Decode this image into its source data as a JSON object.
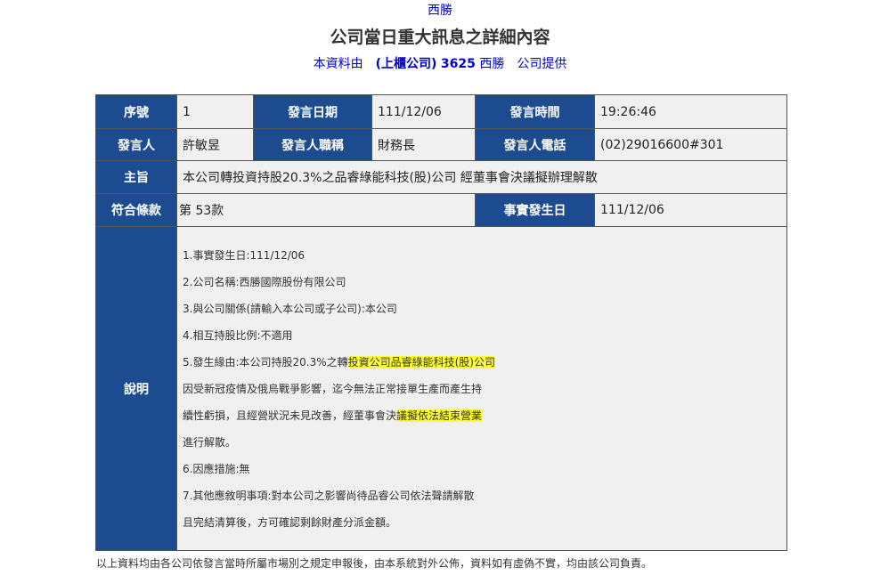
{
  "header": {
    "company_link": "西勝",
    "title": "公司當日重大訊息之詳細內容",
    "provider_prefix": "本資料由　",
    "provider_market": "(上櫃公司)",
    "provider_code": "3625",
    "provider_name": "西勝",
    "provider_suffix": "　公司提供"
  },
  "table": {
    "seq_label": "序號",
    "seq_value": "1",
    "date_label": "發言日期",
    "date_value": "111/12/06",
    "time_label": "發言時間",
    "time_value": "19:26:46",
    "speaker_label": "發言人",
    "speaker_value": "許敏昱",
    "title_label": "發言人職稱",
    "title_value": "財務長",
    "phone_label": "發言人電話",
    "phone_value": "(02)29016600#301",
    "subject_label": "主旨",
    "subject_value": "本公司轉投資持股20.3%之品睿綠能科技(股)公司 經董事會決議擬辦理解散",
    "clause_label": "符合條款",
    "clause_value": "第 53款",
    "event_date_label": "事實發生日",
    "event_date_value": "111/12/06",
    "desc_label": "說明"
  },
  "description": {
    "line1": "1.事實發生日:111/12/06",
    "line2": "2.公司名稱:西勝國際股份有限公司",
    "line3": "3.與公司關係(請輸入本公司或子公司):本公司",
    "line4": "4.相互持股比例:不適用",
    "line5_plain": "5.發生緣由:本公司持股20.3%之轉",
    "line5_highlight": "投資公司品睿綠能科技(股)公司",
    "line6": "因受新冠疫情及俄烏戰爭影響，迄今無法正常接單生產而產生持",
    "line7_plain": "續性虧損，且經營狀況未見改善，經董事會決",
    "line7_highlight": "議擬依法結束營業",
    "line8": "進行解散。",
    "line9": "6.因應措施:無",
    "line10": "7.其他應敘明事項:對本公司之影響尚待品睿公司依法聲請解散",
    "line11": "且完結清算後，方可確認剩餘財產分派金額。"
  },
  "footer": {
    "note": "以上資料均由各公司依發言當時所屬市場別之規定申報後，由本系統對外公佈，資料如有虛偽不實，均由該公司負責。"
  },
  "colors": {
    "header_cell_bg": "#1d4b8f",
    "value_cell_bg": "#f0f0f0",
    "link_blue": "#0000cc",
    "highlight": "#ffff33"
  }
}
